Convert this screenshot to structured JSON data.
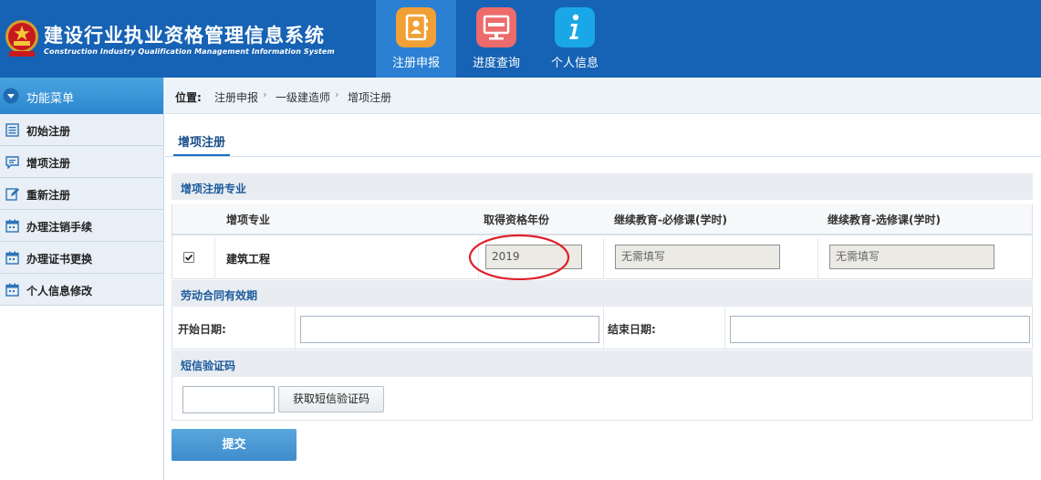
{
  "app": {
    "title_cn": "建设行业执业资格管理信息系统",
    "title_en": "Construction Industry Qualification Management Information System"
  },
  "nav": [
    {
      "label": "注册申报",
      "icon": "contact-book-icon",
      "color": "#f0a034",
      "active": true
    },
    {
      "label": "进度查询",
      "icon": "monitor-icon",
      "color": "#ec6b6b",
      "active": false
    },
    {
      "label": "个人信息",
      "icon": "info-icon",
      "color": "#1aa7e8",
      "active": false
    }
  ],
  "sidebar": {
    "header": "功能菜单",
    "items": [
      {
        "label": "初始注册",
        "icon": "list-icon"
      },
      {
        "label": "增项注册",
        "icon": "chat-icon"
      },
      {
        "label": "重新注册",
        "icon": "edit-icon"
      },
      {
        "label": "办理注销手续",
        "icon": "calendar-icon"
      },
      {
        "label": "办理证书更换",
        "icon": "calendar-icon"
      },
      {
        "label": "个人信息修改",
        "icon": "calendar-icon"
      }
    ]
  },
  "breadcrumb": {
    "label": "位置:",
    "items": [
      "注册申报",
      "一级建造师",
      "增项注册"
    ]
  },
  "tab": {
    "label": "增项注册"
  },
  "specialty_section": {
    "title": "增项注册专业",
    "columns": [
      "增项专业",
      "取得资格年份",
      "继续教育-必修课(学时)",
      "继续教育-选修课(学时)"
    ],
    "row": {
      "checked": true,
      "specialty": "建筑工程",
      "year": "2019",
      "required_hours": "无需填写",
      "elective_hours": "无需填写"
    }
  },
  "contract_section": {
    "title": "劳动合同有效期",
    "start_label": "开始日期:",
    "start_value": "",
    "end_label": "结束日期:",
    "end_value": ""
  },
  "sms_section": {
    "title": "短信验证码",
    "code_value": "",
    "button_label": "获取短信验证码"
  },
  "submit": {
    "label": "提交"
  },
  "colors": {
    "header": "#1662b4",
    "nav_active": "#2b80d4",
    "annotation": "#e0202a"
  }
}
